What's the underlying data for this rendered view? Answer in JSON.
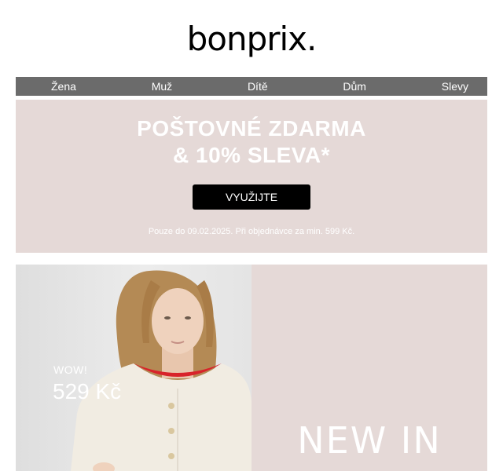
{
  "brand": {
    "logo_text": "bonprix."
  },
  "nav": {
    "items": [
      {
        "label": "Žena"
      },
      {
        "label": "Muž"
      },
      {
        "label": "Dítě"
      },
      {
        "label": "Dům"
      },
      {
        "label": "Slevy"
      }
    ]
  },
  "promo": {
    "title_line1": "POŠTOVNÉ ZDARMA",
    "title_line2": "& 10% SLEVA*",
    "button_label": "VYUŽIJTE",
    "note": "Pouze do 09.02.2025. Při objednávce za min. 599 Kč.",
    "background_color": "#e5d9d7"
  },
  "hero": {
    "tag": "WOW!",
    "price": "529 Kč",
    "headline": "NEW IN"
  }
}
